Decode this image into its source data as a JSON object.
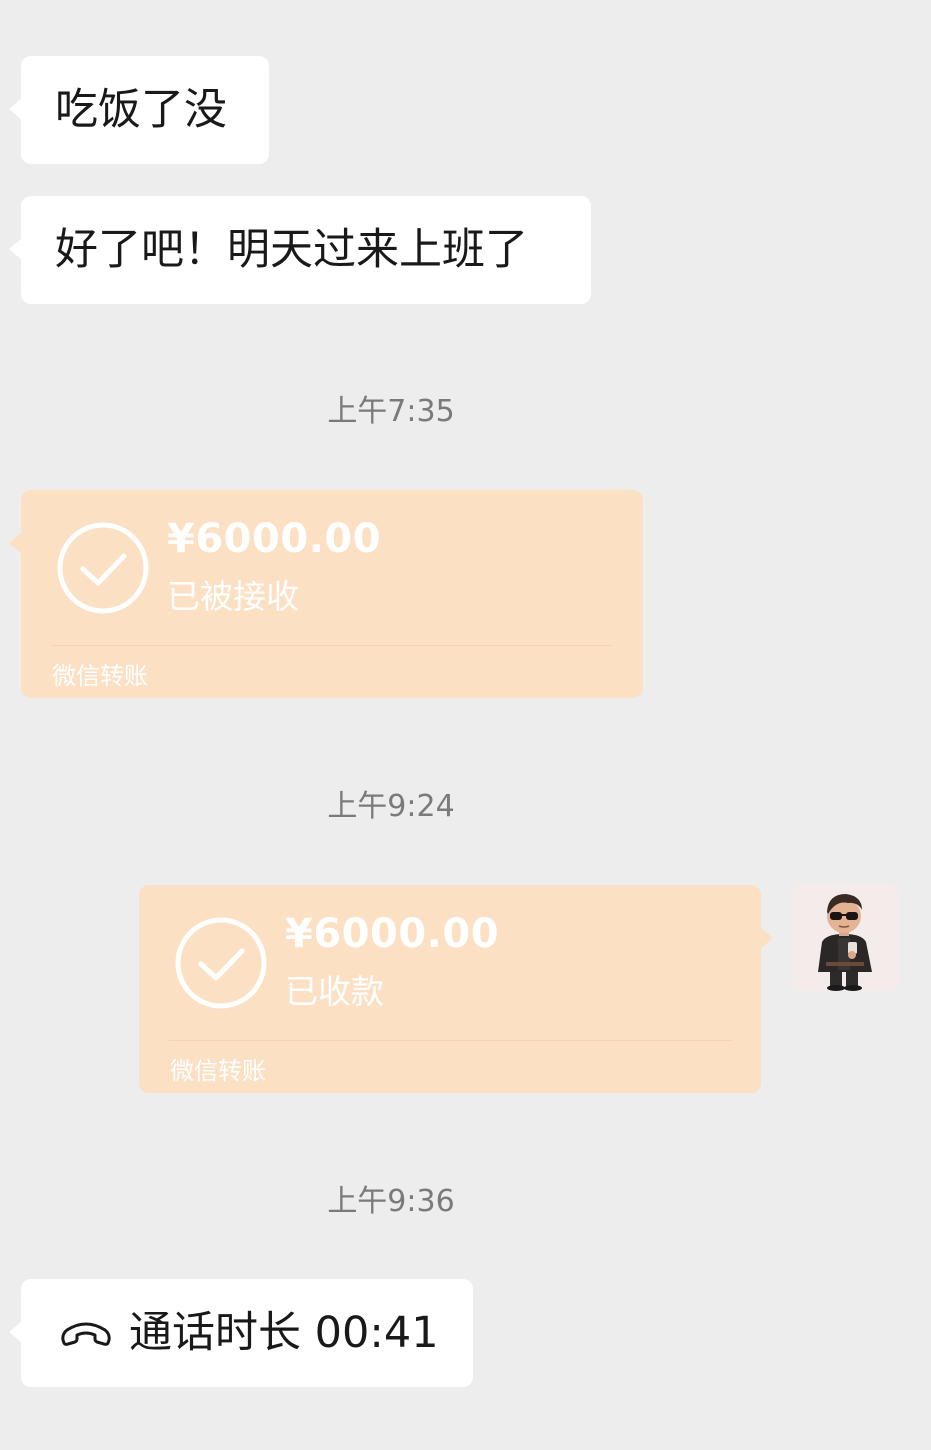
{
  "messages": {
    "m1": {
      "text": "吃饭了没"
    },
    "m2": {
      "text": "好了吧！明天过来上班了"
    }
  },
  "timestamps": {
    "t1": "上午7:35",
    "t2": "上午9:24",
    "t3": "上午9:36"
  },
  "transfers": {
    "received": {
      "amount": "¥6000.00",
      "status": "已被接收",
      "footer": "微信转账"
    },
    "collected": {
      "amount": "¥6000.00",
      "status": "已收款",
      "footer": "微信转账"
    }
  },
  "call": {
    "text": "通话时长 00:41",
    "icon": "phone-handset-icon"
  },
  "avatar": {
    "description_icon": "user-avatar-icon"
  },
  "colors": {
    "background": "#ededed",
    "bubble": "#ffffff",
    "transfer_bg": "#fbe0c4",
    "transfer_text": "#ffffff",
    "timestamp": "#7a7a7a"
  }
}
